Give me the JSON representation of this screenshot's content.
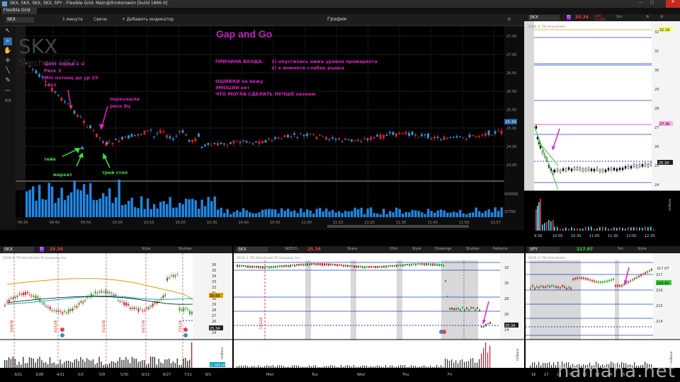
{
  "window": {
    "title": "SKX, SKX, SKX, SKX, SPY - Flexible Grid: Main@thinkorswim [build 1866.9]",
    "tab_label": "Flexible Grid"
  },
  "toolbar": {
    "symbol": "SKX",
    "timeframe": "1 минута",
    "chart_type": "Свечи",
    "add_indicator": "+ Добавить индикатор",
    "chart_label": "График"
  },
  "main_chart": {
    "ticker_watermark": "SKX",
    "company_watermark": "Skechers USA",
    "title": "Gap and Go",
    "notes_left": [
      "Цвет спред 1-2",
      "Риск 3",
      "Min потенц до ур 25",
      "16к1"
    ],
    "entry_reason_label": "ПРИЧИНА ВХОДА:",
    "entry_reasons": [
      "1) опустилась ниже уровня премаркета",
      "2) в моменте слабее рынка"
    ],
    "errors": [
      "ОШИБКИ не вижу",
      "ЭМОЦИИ нет",
      "ЧТО МОГЛА СДЕЛАТЬ ЛУЧШЕ незнаю"
    ],
    "label_peresh": [
      "перезашла",
      "риск 8ц"
    ],
    "label_take": "тейк",
    "label_market": "маркет",
    "label_trail": "трей стоп",
    "y_ticks": [
      "27.50",
      "27.00",
      "26.50",
      "26.00",
      "25.50",
      "25.00",
      "24.50",
      "24.00"
    ],
    "last_price": "25.34",
    "volume_ticks": [
      "500000",
      "37706"
    ],
    "x_ticks": [
      "09:30",
      "09:40",
      "09:50",
      "10:00",
      "10:10",
      "10:20",
      "10:30",
      "10:40",
      "10:50",
      "11:00",
      "11:10",
      "11:20",
      "11:30",
      "11:40",
      "11:50",
      "11:57"
    ]
  },
  "right_top": {
    "symbol": "SKX",
    "price": "25.34",
    "change": "-4.94",
    "change_pct": "-11.22%",
    "copyright": "2016 © TD Ameritrade",
    "y_ticks": [
      "32",
      "31",
      "30",
      "29",
      "28",
      "27",
      "26",
      "25",
      "24"
    ],
    "label_top": "32.18",
    "label_mid": "27.36",
    "label_last": "25.34",
    "x_ticks": [
      "9:30",
      "10:00",
      "10:30",
      "11:00",
      "11:30",
      "12:00",
      "12:30"
    ],
    "vol_unit": "millions"
  },
  "bottom_left": {
    "symbol": "SKX",
    "badge": "D",
    "price": "25.34",
    "style": "Style",
    "studies": "Studies",
    "copyright": "2016 © TD Ameritrade IP Company, Inc.",
    "y_ticks": [
      "36",
      "35",
      "34",
      "33",
      "32",
      "31",
      "30",
      "29",
      "28",
      "27",
      "26",
      "25",
      "24"
    ],
    "last": "25.34",
    "ma_label": "30.69",
    "events": [
      "3/18/16",
      "4/21/16",
      "5/23/16",
      "6/17/16",
      "7/21/16"
    ],
    "x_ticks": [
      "3/21",
      "3/28",
      "4/11",
      "5/2",
      "5/9",
      "5/30",
      "6/13",
      "6/27",
      "7/11",
      "8/1"
    ],
    "vol_label": "2.38918",
    "vol_unit": "millions"
  },
  "bottom_mid": {
    "symbol": "SKX",
    "company": "SKECH...",
    "price": "25.34",
    "share": "Share",
    "interval": "15m",
    "style": "Style",
    "drawings": "Drawings",
    "studies": "Studies",
    "patterns": "Patterns",
    "copyright": "2016 © TD Ameritrade IP Company, Inc.",
    "y_ticks": [
      "32",
      "30",
      "28",
      "26",
      "24"
    ],
    "last": "25.34",
    "event": "7/15/16",
    "x_ticks": [
      "Mon",
      "Tue",
      "Wed",
      "Thu",
      "Fri"
    ],
    "vol_unit": "millions"
  },
  "bottom_right": {
    "symbol": "SPY",
    "price": "217.07",
    "interval": "5m",
    "style": "Style",
    "copyright": "2016 © TD Ameritrade",
    "y_ticks": [
      "217",
      "216",
      "215",
      "214"
    ],
    "label_top": "217.07",
    "label_mid": "216.41",
    "x_ticks": [
      "16",
      "17",
      "18",
      "Fri",
      "12",
      "13",
      "14",
      "15"
    ],
    "vol_unit": "millions"
  },
  "watermark": "hamaha.net",
  "colors": {
    "up": "#2e8fd8",
    "down": "#d0202a",
    "magenta": "#e020c8",
    "green": "#39e539",
    "volume": "#1e88e5"
  }
}
